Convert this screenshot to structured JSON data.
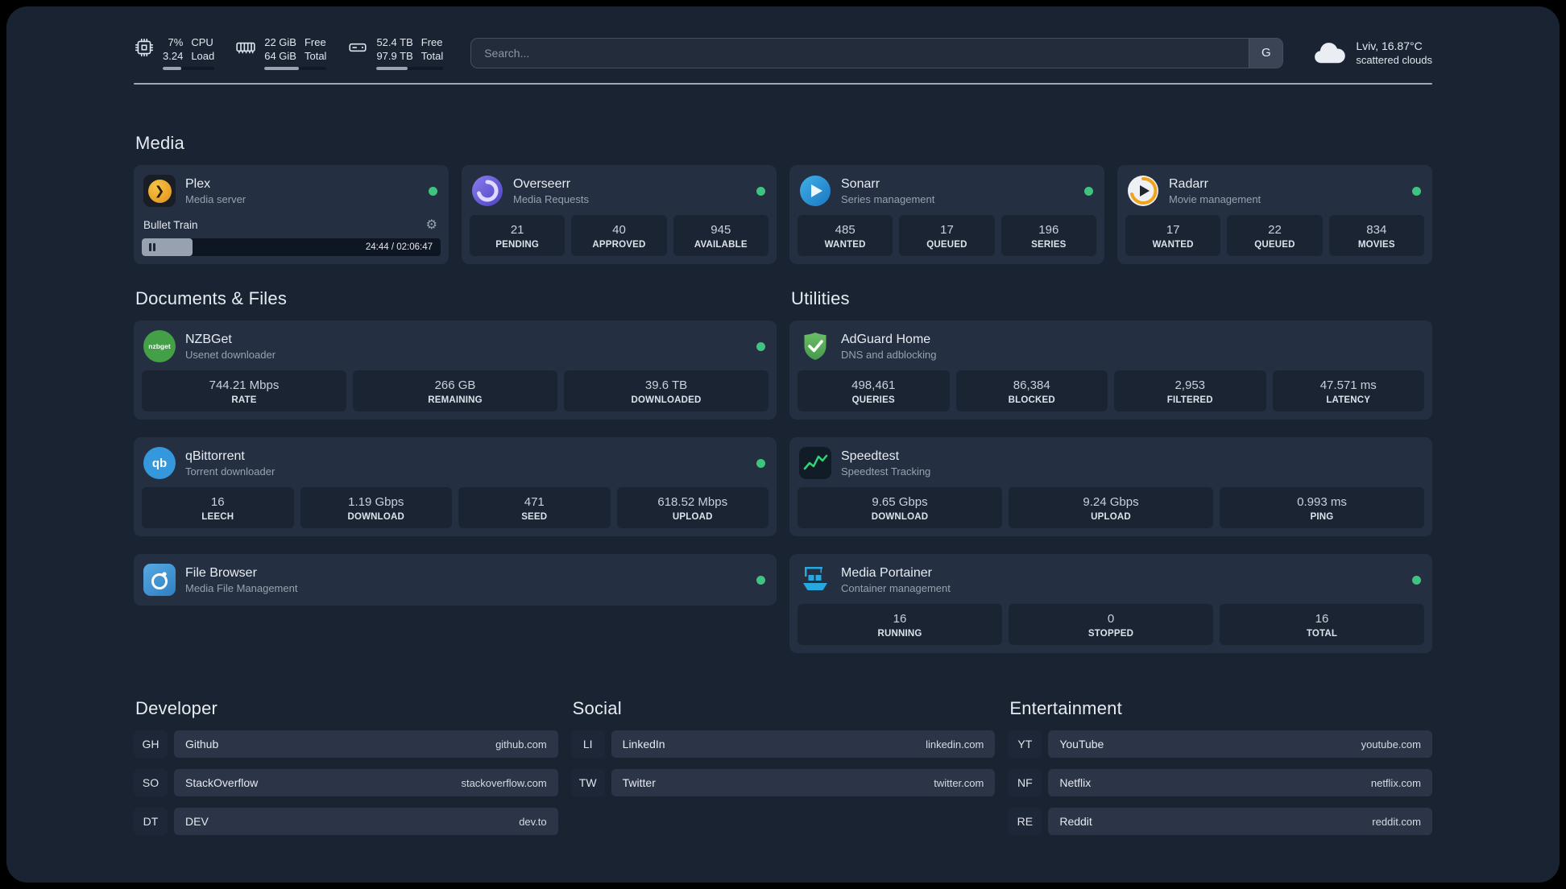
{
  "colors": {
    "background": "#1a2332",
    "card": "#242f41",
    "stat_box": "#1a2433",
    "status_online": "#3fc380",
    "accent_plex": "#e5a00d",
    "accent_overseerr": "#6c5ce7",
    "accent_sonarr": "#35a0d8",
    "accent_radarr": "#f0a21a",
    "accent_nzbget": "#43a047",
    "accent_qbittorrent": "#3598dc",
    "accent_filebrowser": "#4396d8",
    "accent_adguard": "#68bc71",
    "accent_speedtest": "#2fd479",
    "accent_portainer": "#27a9e0"
  },
  "topbar": {
    "resources": [
      {
        "values": [
          "7%",
          "3.24"
        ],
        "labels": [
          "CPU",
          "Load"
        ],
        "bar_style": "width:36%"
      },
      {
        "values": [
          "22 GiB",
          "64 GiB"
        ],
        "labels": [
          "Free",
          "Total"
        ],
        "bar_style": "width:55%"
      },
      {
        "values": [
          "52.4 TB",
          "97.9 TB"
        ],
        "labels": [
          "Free",
          "Total"
        ],
        "bar_style": "width:46%"
      }
    ],
    "search": {
      "placeholder": "Search...",
      "button_label": "G"
    },
    "weather": {
      "location": "Lviv, 16.87°C",
      "condition": "scattered clouds"
    }
  },
  "media": {
    "title": "Media",
    "plex": {
      "name": "Plex",
      "subtitle": "Media server",
      "now_playing": "Bullet Train",
      "time": "24:44 / 02:06:47",
      "progress_style": "width:17%"
    },
    "overseerr": {
      "name": "Overseerr",
      "subtitle": "Media Requests",
      "stats": [
        {
          "value": "21",
          "label": "PENDING"
        },
        {
          "value": "40",
          "label": "APPROVED"
        },
        {
          "value": "945",
          "label": "AVAILABLE"
        }
      ]
    },
    "sonarr": {
      "name": "Sonarr",
      "subtitle": "Series management",
      "stats": [
        {
          "value": "485",
          "label": "WANTED"
        },
        {
          "value": "17",
          "label": "QUEUED"
        },
        {
          "value": "196",
          "label": "SERIES"
        }
      ]
    },
    "radarr": {
      "name": "Radarr",
      "subtitle": "Movie management",
      "stats": [
        {
          "value": "17",
          "label": "WANTED"
        },
        {
          "value": "22",
          "label": "QUEUED"
        },
        {
          "value": "834",
          "label": "MOVIES"
        }
      ]
    }
  },
  "documents": {
    "title": "Documents & Files",
    "nzbget": {
      "name": "NZBGet",
      "subtitle": "Usenet downloader",
      "icon_text": "nzbget",
      "stats": [
        {
          "value": "744.21 Mbps",
          "label": "RATE"
        },
        {
          "value": "266 GB",
          "label": "REMAINING"
        },
        {
          "value": "39.6 TB",
          "label": "DOWNLOADED"
        }
      ]
    },
    "qbittorrent": {
      "name": "qBittorrent",
      "subtitle": "Torrent downloader",
      "icon_text": "qb",
      "stats": [
        {
          "value": "16",
          "label": "LEECH"
        },
        {
          "value": "1.19 Gbps",
          "label": "DOWNLOAD"
        },
        {
          "value": "471",
          "label": "SEED"
        },
        {
          "value": "618.52 Mbps",
          "label": "UPLOAD"
        }
      ]
    },
    "filebrowser": {
      "name": "File Browser",
      "subtitle": "Media File Management"
    }
  },
  "utilities": {
    "title": "Utilities",
    "adguard": {
      "name": "AdGuard Home",
      "subtitle": "DNS and adblocking",
      "stats": [
        {
          "value": "498,461",
          "label": "QUERIES"
        },
        {
          "value": "86,384",
          "label": "BLOCKED"
        },
        {
          "value": "2,953",
          "label": "FILTERED"
        },
        {
          "value": "47.571 ms",
          "label": "LATENCY"
        }
      ]
    },
    "speedtest": {
      "name": "Speedtest",
      "subtitle": "Speedtest Tracking",
      "stats": [
        {
          "value": "9.65 Gbps",
          "label": "DOWNLOAD"
        },
        {
          "value": "9.24 Gbps",
          "label": "UPLOAD"
        },
        {
          "value": "0.993 ms",
          "label": "PING"
        }
      ]
    },
    "portainer": {
      "name": "Media Portainer",
      "subtitle": "Container management",
      "stats": [
        {
          "value": "16",
          "label": "RUNNING"
        },
        {
          "value": "0",
          "label": "STOPPED"
        },
        {
          "value": "16",
          "label": "TOTAL"
        }
      ]
    }
  },
  "bookmarks": {
    "developer": {
      "title": "Developer",
      "items": [
        {
          "abbr": "GH",
          "name": "Github",
          "url": "github.com"
        },
        {
          "abbr": "SO",
          "name": "StackOverflow",
          "url": "stackoverflow.com"
        },
        {
          "abbr": "DT",
          "name": "DEV",
          "url": "dev.to"
        }
      ]
    },
    "social": {
      "title": "Social",
      "items": [
        {
          "abbr": "LI",
          "name": "LinkedIn",
          "url": "linkedin.com"
        },
        {
          "abbr": "TW",
          "name": "Twitter",
          "url": "twitter.com"
        }
      ]
    },
    "entertainment": {
      "title": "Entertainment",
      "items": [
        {
          "abbr": "YT",
          "name": "YouTube",
          "url": "youtube.com"
        },
        {
          "abbr": "NF",
          "name": "Netflix",
          "url": "netflix.com"
        },
        {
          "abbr": "RE",
          "name": "Reddit",
          "url": "reddit.com"
        }
      ]
    }
  }
}
